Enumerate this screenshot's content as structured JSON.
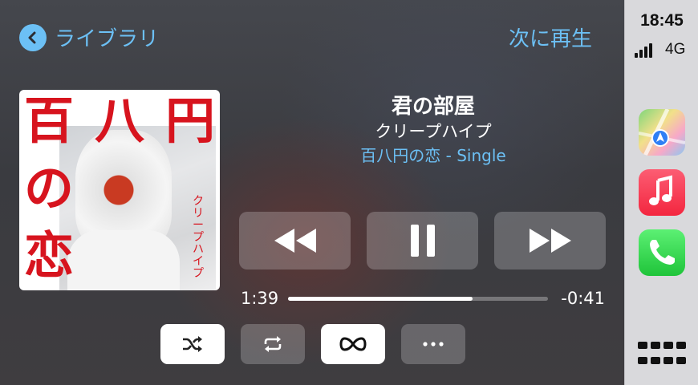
{
  "header": {
    "back_label": "ライブラリ",
    "up_next_label": "次に再生"
  },
  "artwork": {
    "chars": [
      "百",
      "八",
      "円",
      "の",
      "恋"
    ],
    "artist_vertical": "クリープハイプ"
  },
  "track": {
    "title": "君の部屋",
    "artist": "クリープハイプ",
    "album": "百八円の恋 - Single"
  },
  "playback": {
    "elapsed": "1:39",
    "remaining": "-0:41",
    "progress_fraction": 0.71,
    "state": "playing"
  },
  "options": {
    "shuffle_on": false,
    "repeat_on": false,
    "autoplay_on": true
  },
  "status": {
    "time": "18:45",
    "network": "4G"
  },
  "sidebar": {
    "apps": [
      "maps-icon",
      "music-icon",
      "phone-icon"
    ]
  },
  "colors": {
    "accent": "#6cc0f5",
    "artwork_red": "#d7141e"
  }
}
